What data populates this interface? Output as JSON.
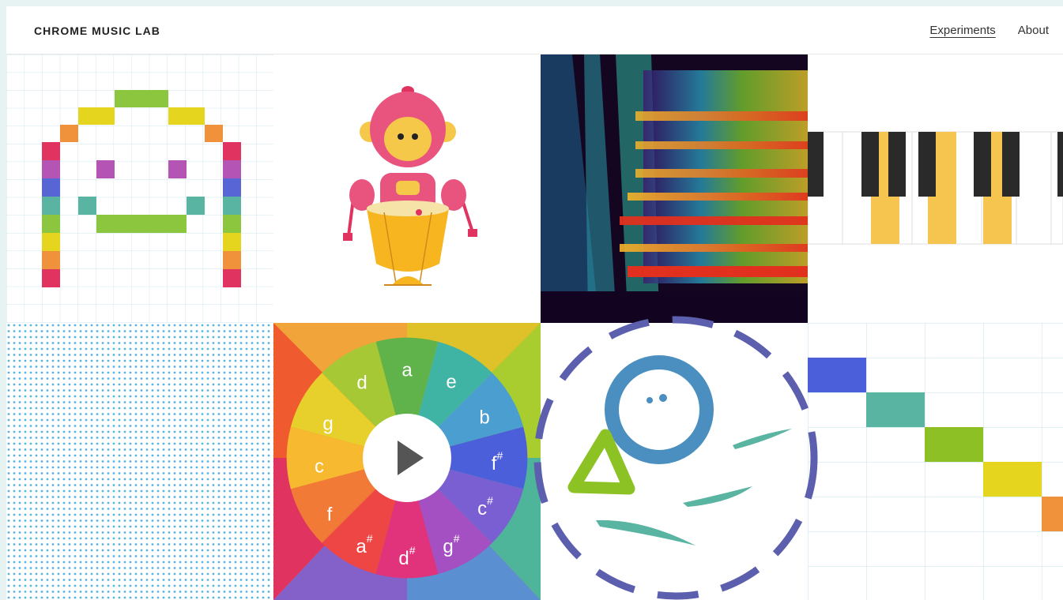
{
  "header": {
    "brand": "CHROME MUSIC LAB",
    "nav": [
      {
        "label": "Experiments",
        "active": true
      },
      {
        "label": "About",
        "active": false
      }
    ]
  },
  "experiments": [
    {
      "id": "song-maker",
      "icon": "pixel-face-icon"
    },
    {
      "id": "rhythm",
      "icon": "monkey-drummer-icon"
    },
    {
      "id": "spectrogram",
      "icon": "spectrogram-icon"
    },
    {
      "id": "piano-roll",
      "icon": "piano-keys-icon"
    },
    {
      "id": "voice-spinner",
      "icon": "dot-grid-icon"
    },
    {
      "id": "chords",
      "icon": "note-wheel-icon"
    },
    {
      "id": "kandinsky",
      "icon": "doodle-face-icon"
    },
    {
      "id": "melody-maker",
      "icon": "step-grid-icon"
    }
  ],
  "chord_wheel": {
    "notes": [
      "a",
      "e",
      "b",
      "f",
      "c",
      "g",
      "d",
      "a",
      "f",
      "c",
      "g",
      "d"
    ],
    "sharps": [
      false,
      false,
      false,
      true,
      true,
      true,
      true,
      true,
      false,
      false,
      false,
      false
    ],
    "play_icon": "play-icon"
  },
  "colors": {
    "background": "#e7f3f2",
    "highlight_ring": "#5b5fae"
  }
}
